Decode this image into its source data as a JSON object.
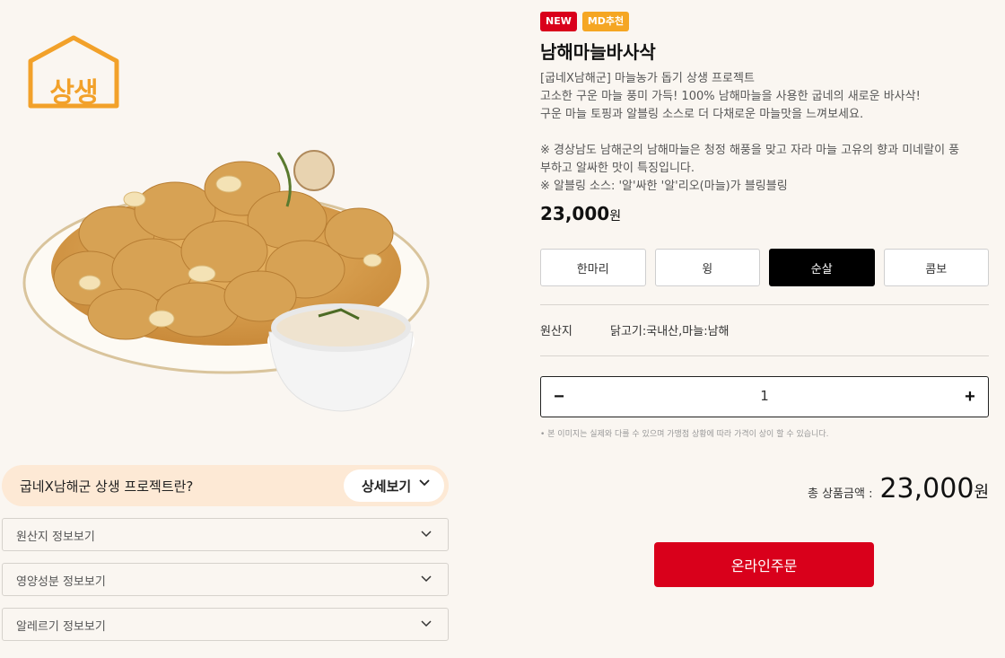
{
  "brand": {
    "logo_text": "상생"
  },
  "product": {
    "badges": [
      "NEW",
      "MD추천"
    ],
    "name": "남해마늘바사삭",
    "description": [
      "[굽네X남해군] 마늘농가 돕기 상생 프로젝트",
      "고소한 구운 마늘 풍미 가득! 100% 남해마늘을 사용한 굽네의 새로운 바사삭!",
      "구운 마늘 토핑과 알블링 소스로 더 다채로운 마늘맛을 느껴보세요.",
      "",
      "※ 경상남도 남해군의 남해마늘은 청정 해풍을 맞고 자라 마늘 고유의 향과 미네랄이 풍",
      "부하고 알싸한 맛이 특징입니다.",
      "※ 알블링 소스: '알'싸한 '알'리오(마늘)가 블링블링"
    ],
    "price": "23,000",
    "currency": "원"
  },
  "options": [
    {
      "label": "한마리",
      "active": false
    },
    {
      "label": "윙",
      "active": false
    },
    {
      "label": "순살",
      "active": true
    },
    {
      "label": "콤보",
      "active": false
    }
  ],
  "origin": {
    "label": "원산지",
    "value": "닭고기:국내산,마늘:남해"
  },
  "quantity": {
    "minus": "−",
    "value": "1",
    "plus": "+"
  },
  "note": "• 본 이미지는 실제와 다를 수 있으며 가맹점 상황에 따라 가격이 상이 할 수 있습니다.",
  "total": {
    "label": "총 상품금액 :",
    "amount": "23,000",
    "currency": "원"
  },
  "order_button": "온라인주문",
  "promo": {
    "text": "굽네X남해군 상생 프로젝트란?",
    "button": "상세보기"
  },
  "accordions": [
    "원산지 정보보기",
    "영양성분 정보보기",
    "알레르기 정보보기"
  ],
  "colors": {
    "accent": "#d9001b",
    "badge_md": "#f5a623",
    "promo_bg": "#fde9d5",
    "logo": "#f2a12a"
  },
  "icons": {
    "dropdown": "chevron-down-icon"
  }
}
